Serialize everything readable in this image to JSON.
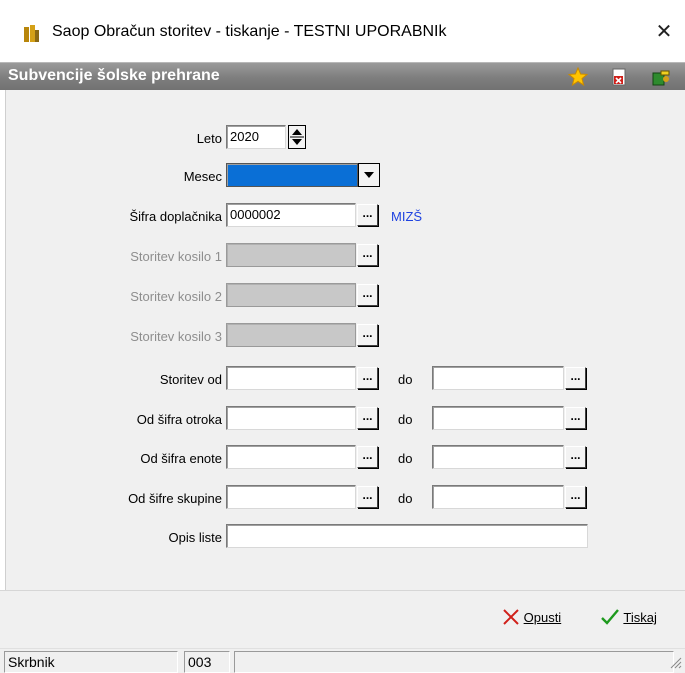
{
  "window": {
    "title": "Saop Obračun storitev - tiskanje - TESTNI UPORABNIk",
    "close_label": "✕"
  },
  "header": {
    "title": "Subvencije šolske prehrane",
    "icons": [
      "star-icon",
      "delete-report-icon",
      "exit-icon"
    ]
  },
  "form": {
    "leto": {
      "label": "Leto",
      "value": "2020"
    },
    "mesec": {
      "label": "Mesec",
      "value": ""
    },
    "sifra_doplacnika": {
      "label": "Šifra doplačnika",
      "value": "0000002",
      "link": "MIZŠ"
    },
    "storitev_kosilo_1": {
      "label": "Storitev kosilo 1",
      "value": ""
    },
    "storitev_kosilo_2": {
      "label": "Storitev kosilo 2",
      "value": ""
    },
    "storitev_kosilo_3": {
      "label": "Storitev kosilo 3",
      "value": ""
    },
    "storitev_od": {
      "label": "Storitev od",
      "value": "",
      "to_label": "do",
      "to_value": ""
    },
    "od_sifra_otroka": {
      "label": "Od šifra otroka",
      "value": "",
      "to_label": "do",
      "to_value": ""
    },
    "od_sifra_enote": {
      "label": "Od šifra enote",
      "value": "",
      "to_label": "do",
      "to_value": ""
    },
    "od_sifre_skupine": {
      "label": "Od šifre skupine",
      "value": "",
      "to_label": "do",
      "to_value": ""
    },
    "opis_liste": {
      "label": "Opis liste",
      "value": ""
    },
    "browse_label": "..."
  },
  "footer": {
    "cancel_label": "Opusti",
    "print_label": "Tiskaj"
  },
  "status": {
    "user": "Skrbnik",
    "code": "003",
    "extra": ""
  },
  "colors": {
    "header_bg": "#7e7e7e",
    "selected_field": "#0a6fd6",
    "link": "#1f43e0",
    "cancel_icon": "#d0201a",
    "print_icon": "#1e9a1e"
  }
}
